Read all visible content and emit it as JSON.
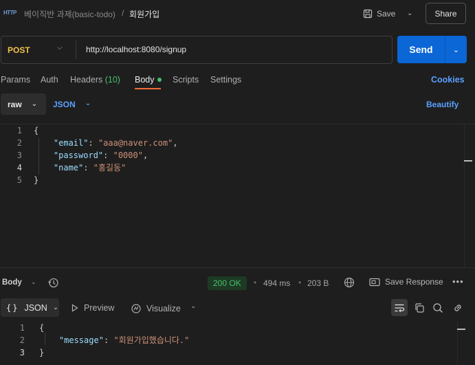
{
  "header": {
    "http_badge": "HTTP",
    "collection": "베이직반 과제(basic-todo)",
    "separator": "/",
    "request_name": "회원가입",
    "save_label": "Save",
    "share_label": "Share"
  },
  "request": {
    "method": "POST",
    "url": "http://localhost:8080/signup",
    "send_label": "Send"
  },
  "tabs": {
    "params": "Params",
    "auth": "Auth",
    "headers": "Headers",
    "headers_count": "(10)",
    "body": "Body",
    "scripts": "Scripts",
    "settings": "Settings",
    "cookies": "Cookies"
  },
  "body_options": {
    "mode": "raw",
    "language": "JSON",
    "beautify": "Beautify"
  },
  "request_body": {
    "line_numbers": [
      "1",
      "2",
      "3",
      "4",
      "5"
    ],
    "open_brace": "{",
    "close_brace": "}",
    "email_key": "\"email\"",
    "email_value": "\"aaa@naver.com\"",
    "password_key": "\"password\"",
    "password_value": "\"0000\"",
    "name_key": "\"name\"",
    "name_value": "\"홍길동\""
  },
  "response": {
    "section_label": "Body",
    "status": "200 OK",
    "time": "494 ms",
    "size": "203 B",
    "save_response": "Save Response",
    "format": "JSON",
    "format_icon": "{}",
    "preview": "Preview",
    "visualize": "Visualize",
    "line_numbers": [
      "1",
      "2",
      "3"
    ],
    "open_brace": "{",
    "close_brace": "}",
    "message_key": "\"message\"",
    "message_value": "\"회원가입했습니다.\""
  },
  "colors": {
    "accent_blue": "#0b66d6",
    "method_post": "#f0c24a",
    "status_ok": "#49c06b",
    "active_tab_underline": "#f26b3a"
  }
}
